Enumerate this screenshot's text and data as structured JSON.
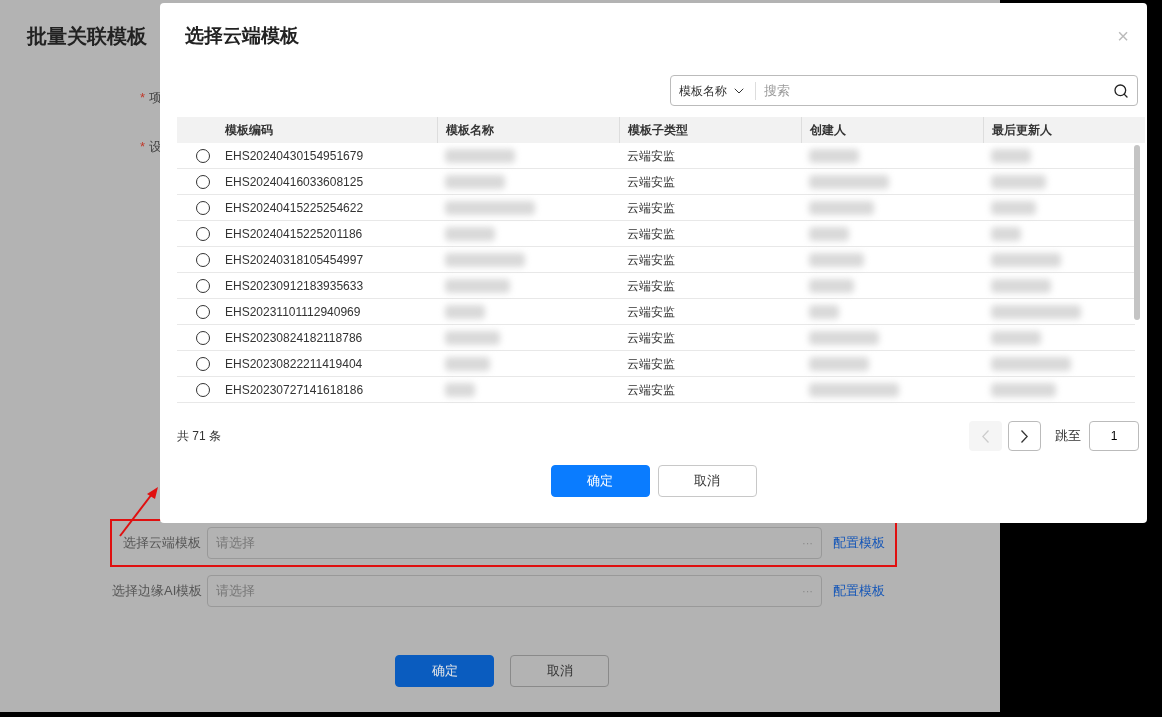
{
  "background_dialog": {
    "title": "批量关联模板",
    "fields": [
      {
        "label": "项",
        "required_mark": "*"
      },
      {
        "label": "设",
        "required_mark": "*"
      }
    ],
    "template_rows": [
      {
        "label": "选择云端模板",
        "placeholder": "请选择",
        "more": "···",
        "link": "配置模板",
        "highlighted": true
      },
      {
        "label": "选择边缘AI模板",
        "placeholder": "请选择",
        "more": "···",
        "link": "配置模板",
        "highlighted": false
      }
    ],
    "buttons": [
      {
        "label": "确定",
        "kind": "primary"
      },
      {
        "label": "取消",
        "kind": "default"
      }
    ]
  },
  "modal": {
    "title": "选择云端模板",
    "close": "×",
    "search": {
      "filter_label": "模板名称",
      "placeholder": "搜索"
    },
    "columns": [
      "模板编码",
      "模板名称",
      "模板子类型",
      "创建人",
      "最后更新人"
    ],
    "rows": [
      {
        "code": "EHS20240430154951679",
        "type": "云端安监",
        "selected": false
      },
      {
        "code": "EHS20240416033608125",
        "type": "云端安监",
        "selected": false
      },
      {
        "code": "EHS20240415225254622",
        "type": "云端安监",
        "selected": false
      },
      {
        "code": "EHS20240415225201186",
        "type": "云端安监",
        "selected": false
      },
      {
        "code": "EHS20240318105454997",
        "type": "云端安监",
        "selected": false
      },
      {
        "code": "EHS20230912183935633",
        "type": "云端安监",
        "selected": false
      },
      {
        "code": "EHS20231101112940969",
        "type": "云端安监",
        "selected": false
      },
      {
        "code": "EHS20230824182118786",
        "type": "云端安监",
        "selected": false
      },
      {
        "code": "EHS20230822211419404",
        "type": "云端安监",
        "selected": false
      },
      {
        "code": "EHS20230727141618186",
        "type": "云端安监",
        "selected": false
      }
    ],
    "pagination": {
      "total": "共 71 条",
      "prev_disabled": true,
      "next_disabled": false,
      "jump_label": "跳至",
      "page": "1"
    },
    "buttons": [
      {
        "label": "确定",
        "kind": "primary"
      },
      {
        "label": "取消",
        "kind": "default"
      }
    ]
  }
}
